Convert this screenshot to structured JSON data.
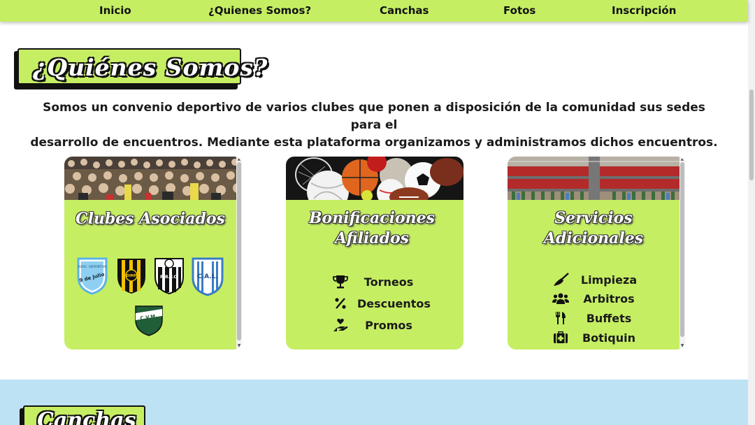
{
  "nav": {
    "items": [
      "Inicio",
      "¿Quienes Somos?",
      "Canchas",
      "Fotos",
      "Inscripción"
    ]
  },
  "about": {
    "title": "¿Quiénes Somos?",
    "intro_line1": "Somos un convenio deportivo de varios clubes que ponen a disposición de la comunidad sus sedes para el",
    "intro_line2": "desarrollo de encuentros. Mediante esta plataforma organizamos y administramos dichos encuentros."
  },
  "cards": [
    {
      "title": "Clubes Asociados",
      "image": "crowd-photo",
      "crests": [
        {
          "icon": "club-9-de-julio-crest-icon",
          "text_top": "ASOC. DEPORTIVA",
          "text_main": "9 de Julio",
          "color": "#5ab3e6"
        },
        {
          "icon": "club-dimp-crest-icon",
          "text_main": "DIMP",
          "color": "#f2c200"
        },
        {
          "icon": "club-rbfc-crest-icon",
          "text_main": "R.B.F.C.",
          "color": "#222222"
        },
        {
          "icon": "club-cal-crest-icon",
          "text_main": "C.A.L.",
          "color": "#3a7cc4"
        },
        {
          "icon": "club-cvm-crest-icon",
          "text_main": "C.V.M.",
          "color": "#1f5e37"
        }
      ]
    },
    {
      "title_line1": "Bonificaciones",
      "title_line2": "Afiliados",
      "image": "sports-balls-photo",
      "items": [
        {
          "icon": "trophy-icon",
          "label": "Torneos"
        },
        {
          "icon": "percent-icon",
          "label": "Descuentos"
        },
        {
          "icon": "hand-heart-icon",
          "label": "Promos"
        }
      ]
    },
    {
      "title_line1": "Servicios",
      "title_line2": "Adicionales",
      "image": "bar-shelves-photo",
      "items": [
        {
          "icon": "broom-icon",
          "label": "Limpieza"
        },
        {
          "icon": "users-icon",
          "label": "Arbitros"
        },
        {
          "icon": "utensils-icon",
          "label": "Buffets"
        },
        {
          "icon": "first-aid-icon",
          "label": "Botiquin"
        }
      ]
    }
  ],
  "canchas": {
    "title": "Canchas"
  },
  "colors": {
    "accent": "#c6ee63",
    "section_blue": "#bde2f4",
    "text_dark": "#1b1b1b"
  }
}
